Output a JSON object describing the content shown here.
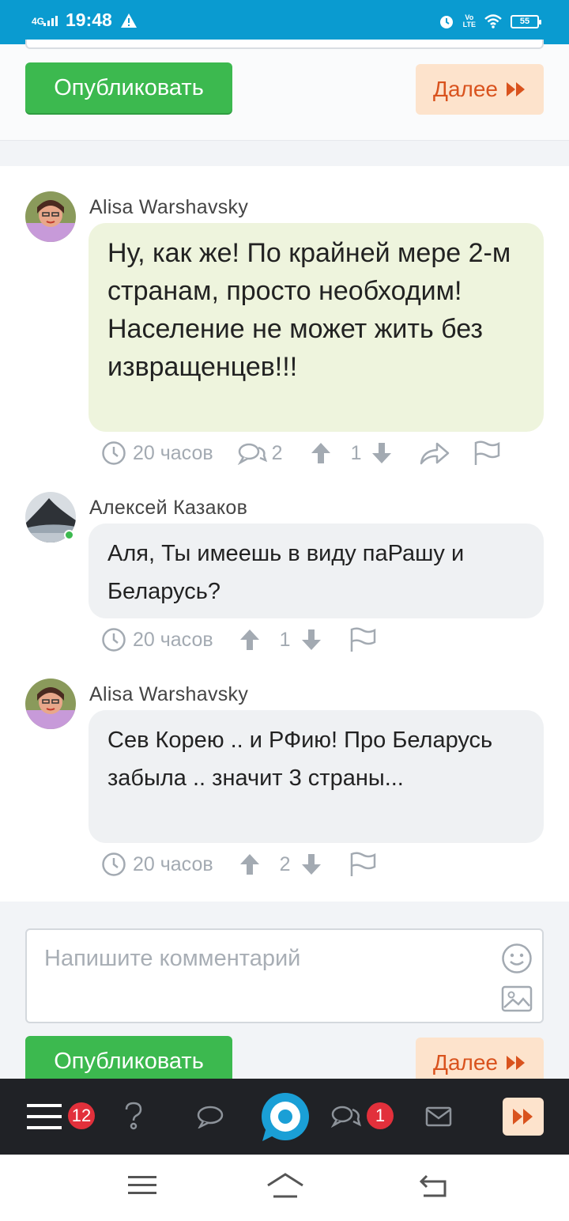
{
  "status_bar": {
    "network": "4G",
    "time": "19:48",
    "volte": "Vo\nLTE",
    "battery": "55"
  },
  "top_actions": {
    "publish_label": "Опубликовать",
    "next_label": "Далее"
  },
  "comments": [
    {
      "author": "Alisa Warshavsky",
      "text": "Ну, как же! По крайней мере 2-м странам, просто необходим! Население не может жить без извращенцев!!!",
      "time": "20 часов",
      "replies": "2",
      "votes": "1"
    },
    {
      "author": "Алексей Казаков",
      "text": "Аля, Ты имеешь в виду паРашу и Беларусь?",
      "time": "20 часов",
      "votes": "1",
      "online": true
    },
    {
      "author": "Alisa Warshavsky",
      "text": "Сев Корею .. и РФию! Про Беларусь забыла .. значит 3 страны...",
      "time": "20 часов",
      "votes": "2"
    }
  ],
  "composer": {
    "placeholder": "Напишите комментарий",
    "publish_label": "Опубликовать",
    "next_label": "Далее"
  },
  "app_nav": {
    "menu_badge": "12",
    "messages_badge": "1"
  },
  "colors": {
    "status_bar": "#0a9bd0",
    "publish": "#3cb94f",
    "next_bg": "#fde3cc",
    "next_text": "#d9531e",
    "badge": "#e2303b",
    "brand_ring": "#1a9fd6"
  },
  "icons": [
    "warning-icon",
    "alarm-icon",
    "wifi-icon",
    "clock-icon",
    "comments-icon",
    "arrow-up-icon",
    "arrow-down-icon",
    "share-icon",
    "flag-icon",
    "smile-icon",
    "image-icon",
    "menu-icon",
    "question-icon",
    "chat-icon",
    "logo-icon",
    "mail-icon",
    "fast-forward-icon"
  ]
}
